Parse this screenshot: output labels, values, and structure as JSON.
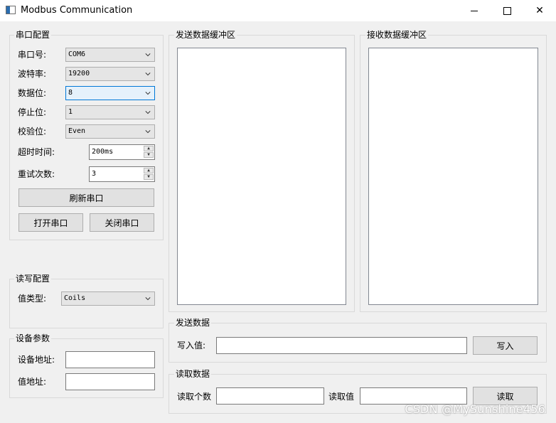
{
  "window": {
    "title": "Modbus Communication",
    "minimize_label": "",
    "maximize_label": "",
    "close_label": "✕"
  },
  "serial_config": {
    "title": "串口配置",
    "port_label": "串口号:",
    "port_value": "COM6",
    "baud_label": "波特率:",
    "baud_value": "19200",
    "databits_label": "数据位:",
    "databits_value": "8",
    "stopbits_label": "停止位:",
    "stopbits_value": "1",
    "parity_label": "校验位:",
    "parity_value": "Even",
    "timeout_label": "超时时间:",
    "timeout_value": "200ms",
    "retry_label": "重试次数:",
    "retry_value": "3",
    "refresh_button": "刷新串口",
    "open_button": "打开串口",
    "close_button": "关闭串口"
  },
  "rw_config": {
    "title": "读写配置",
    "value_type_label": "值类型:",
    "value_type_value": "Coils"
  },
  "device_params": {
    "title": "设备参数",
    "device_address_label": "设备地址:",
    "value_address_label": "值地址:"
  },
  "send_buffer": {
    "title": "发送数据缓冲区"
  },
  "receive_buffer": {
    "title": "接收数据缓冲区"
  },
  "send_data": {
    "title": "发送数据",
    "write_label": "写入值:",
    "write_button": "写入"
  },
  "read_data": {
    "title": "读取数据",
    "count_label": "读取个数",
    "value_label": "读取值",
    "read_button": "读取"
  },
  "watermark": "CSDN @MySunshine456"
}
